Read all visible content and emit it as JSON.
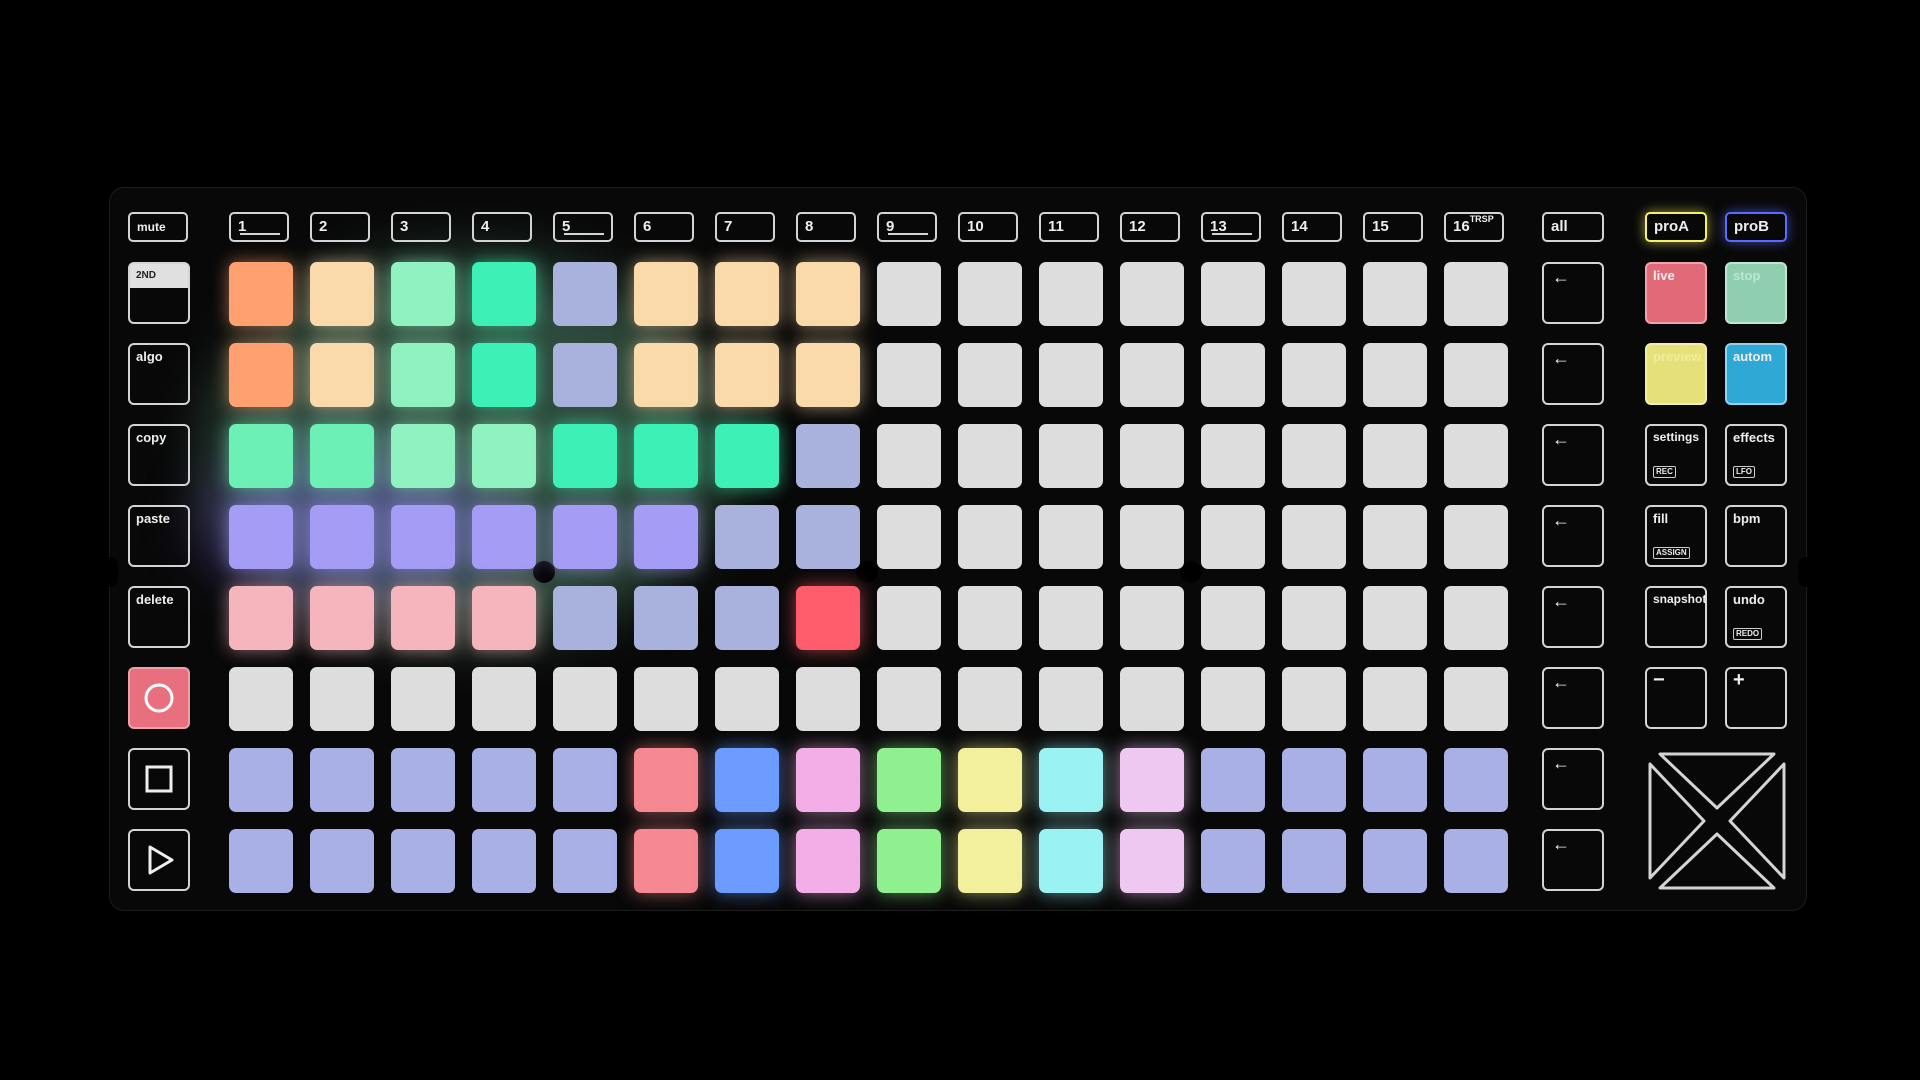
{
  "left_column": {
    "mute_label": "mute",
    "second_label": "2ND",
    "algo_label": "algo",
    "copy_label": "copy",
    "paste_label": "paste",
    "delete_label": "delete",
    "record_icon": "circle-icon",
    "stop_icon": "square-icon",
    "play_icon": "play-triangle-icon"
  },
  "track_buttons": [
    "1",
    "2",
    "3",
    "4",
    "5",
    "6",
    "7",
    "8",
    "9",
    "10",
    "11",
    "12",
    "13",
    "14",
    "15",
    "16"
  ],
  "track16_suffix": "TRSP",
  "right_column": {
    "all_label": "all",
    "arrow_icon": "left-arrow-icon",
    "proA_label": "proA",
    "proB_label": "proB",
    "live_label": "live",
    "stop_label": "stop",
    "preview_label": "preview",
    "autom_label": "autom",
    "settings_label": "settings",
    "settings_sub": "REC",
    "effects_label": "effects",
    "effects_sub": "LFO",
    "fill_label": "fill",
    "fill_sub": "ASSIGN",
    "bpm_label": "bpm",
    "snapshot_label": "snapshot",
    "undo_label": "undo",
    "undo_sub": "REDO",
    "minus_label": "−",
    "plus_label": "+",
    "dpad_icon": "x-dpad-icon"
  },
  "colors": {
    "orange": "#ffa070",
    "peach": "#fad9aa",
    "mint": "#8ff2c0",
    "teal": "#3df0b6",
    "lavender": "#a9b2dd",
    "green": "#6df0b5",
    "violet": "#a49cf5",
    "pink": "#f5b5bc",
    "red": "#ff5c6c",
    "white": "#dddddd",
    "periwinkle": "#a8b0e6",
    "salmon": "#f58890",
    "blue": "#6c9cff",
    "magenta": "#f3aee8",
    "lime": "#8ff08f",
    "yellow": "#f2f09c",
    "cyan": "#9af2f2",
    "lilac": "#efc8f2"
  },
  "pad_grid": [
    [
      "orange",
      "peach",
      "mint",
      "teal",
      "lavender",
      "peach",
      "peach",
      "peach",
      "white",
      "white",
      "white",
      "white",
      "white",
      "white",
      "white",
      "white"
    ],
    [
      "orange",
      "peach",
      "mint",
      "teal",
      "lavender",
      "peach",
      "peach",
      "peach",
      "white",
      "white",
      "white",
      "white",
      "white",
      "white",
      "white",
      "white"
    ],
    [
      "green",
      "green",
      "mint",
      "mint",
      "teal",
      "teal",
      "teal",
      "lavender",
      "white",
      "white",
      "white",
      "white",
      "white",
      "white",
      "white",
      "white"
    ],
    [
      "violet",
      "violet",
      "violet",
      "violet",
      "violet",
      "violet",
      "lavender",
      "lavender",
      "white",
      "white",
      "white",
      "white",
      "white",
      "white",
      "white",
      "white"
    ],
    [
      "pink",
      "pink",
      "pink",
      "pink",
      "lavender",
      "lavender",
      "lavender",
      "red",
      "white",
      "white",
      "white",
      "white",
      "white",
      "white",
      "white",
      "white"
    ],
    [
      "white",
      "white",
      "white",
      "white",
      "white",
      "white",
      "white",
      "white",
      "white",
      "white",
      "white",
      "white",
      "white",
      "white",
      "white",
      "white"
    ],
    [
      "periwinkle",
      "periwinkle",
      "periwinkle",
      "periwinkle",
      "periwinkle",
      "salmon",
      "blue",
      "magenta",
      "lime",
      "yellow",
      "cyan",
      "lilac",
      "periwinkle",
      "periwinkle",
      "periwinkle",
      "periwinkle"
    ],
    [
      "periwinkle",
      "periwinkle",
      "periwinkle",
      "periwinkle",
      "periwinkle",
      "salmon",
      "blue",
      "magenta",
      "lime",
      "yellow",
      "cyan",
      "lilac",
      "periwinkle",
      "periwinkle",
      "periwinkle",
      "periwinkle"
    ]
  ]
}
